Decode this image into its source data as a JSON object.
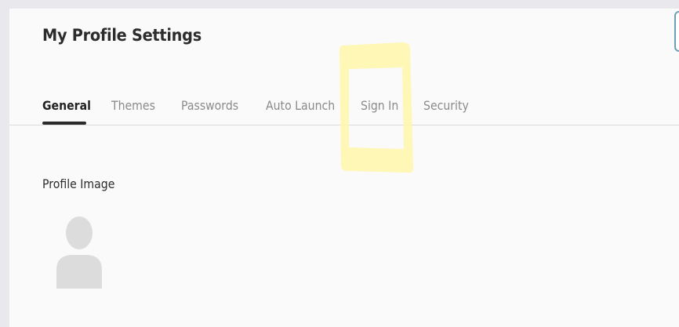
{
  "page": {
    "title": "My Profile Settings"
  },
  "tabs": [
    {
      "label": "General",
      "active": true
    },
    {
      "label": "Themes",
      "active": false
    },
    {
      "label": "Passwords",
      "active": false
    },
    {
      "label": "Auto Launch",
      "active": false
    },
    {
      "label": "Sign In",
      "active": false
    },
    {
      "label": "Security",
      "active": false
    }
  ],
  "profile": {
    "image_label": "Profile Image",
    "avatar_icon": "user-silhouette-icon"
  },
  "annotation": {
    "highlight_color": "#fff6a8",
    "highlighted_tab": "Sign In"
  },
  "colors": {
    "background": "#e9e8ec",
    "panel": "#fafafa",
    "active_tab": "#222222",
    "inactive_tab": "#8a8a8a",
    "avatar": "#dcdcdc"
  }
}
